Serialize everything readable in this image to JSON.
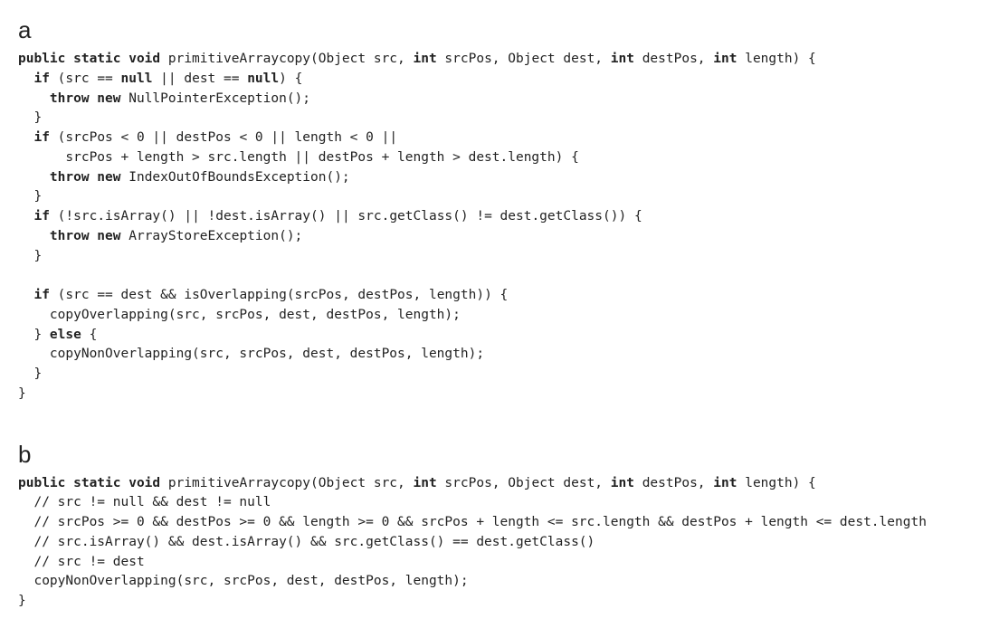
{
  "panels": {
    "a": {
      "label": "a",
      "code_tokens": [
        {
          "t": "kw",
          "v": "public static void"
        },
        {
          "t": "tx",
          "v": " primitiveArraycopy(Object src, "
        },
        {
          "t": "kw",
          "v": "int"
        },
        {
          "t": "tx",
          "v": " srcPos, Object dest, "
        },
        {
          "t": "kw",
          "v": "int"
        },
        {
          "t": "tx",
          "v": " destPos, "
        },
        {
          "t": "kw",
          "v": "int"
        },
        {
          "t": "tx",
          "v": " length) {\n"
        },
        {
          "t": "tx",
          "v": "  "
        },
        {
          "t": "kw",
          "v": "if"
        },
        {
          "t": "tx",
          "v": " (src == "
        },
        {
          "t": "kw",
          "v": "null"
        },
        {
          "t": "tx",
          "v": " || dest == "
        },
        {
          "t": "kw",
          "v": "null"
        },
        {
          "t": "tx",
          "v": ") {\n"
        },
        {
          "t": "tx",
          "v": "    "
        },
        {
          "t": "kw",
          "v": "throw new"
        },
        {
          "t": "tx",
          "v": " NullPointerException();\n"
        },
        {
          "t": "tx",
          "v": "  }\n"
        },
        {
          "t": "tx",
          "v": "  "
        },
        {
          "t": "kw",
          "v": "if"
        },
        {
          "t": "tx",
          "v": " (srcPos < 0 || destPos < 0 || length < 0 ||\n"
        },
        {
          "t": "tx",
          "v": "      srcPos + length > src.length || destPos + length > dest.length) {\n"
        },
        {
          "t": "tx",
          "v": "    "
        },
        {
          "t": "kw",
          "v": "throw new"
        },
        {
          "t": "tx",
          "v": " IndexOutOfBoundsException();\n"
        },
        {
          "t": "tx",
          "v": "  }\n"
        },
        {
          "t": "tx",
          "v": "  "
        },
        {
          "t": "kw",
          "v": "if"
        },
        {
          "t": "tx",
          "v": " (!src.isArray() || !dest.isArray() || src.getClass() != dest.getClass()) {\n"
        },
        {
          "t": "tx",
          "v": "    "
        },
        {
          "t": "kw",
          "v": "throw new"
        },
        {
          "t": "tx",
          "v": " ArrayStoreException();\n"
        },
        {
          "t": "tx",
          "v": "  }\n"
        },
        {
          "t": "tx",
          "v": "\n"
        },
        {
          "t": "tx",
          "v": "  "
        },
        {
          "t": "kw",
          "v": "if"
        },
        {
          "t": "tx",
          "v": " (src == dest && isOverlapping(srcPos, destPos, length)) {\n"
        },
        {
          "t": "tx",
          "v": "    copyOverlapping(src, srcPos, dest, destPos, length);\n"
        },
        {
          "t": "tx",
          "v": "  } "
        },
        {
          "t": "kw",
          "v": "else"
        },
        {
          "t": "tx",
          "v": " {\n"
        },
        {
          "t": "tx",
          "v": "    copyNonOverlapping(src, srcPos, dest, destPos, length);\n"
        },
        {
          "t": "tx",
          "v": "  }\n"
        },
        {
          "t": "tx",
          "v": "}\n"
        }
      ]
    },
    "b": {
      "label": "b",
      "code_tokens": [
        {
          "t": "kw",
          "v": "public static void"
        },
        {
          "t": "tx",
          "v": " primitiveArraycopy(Object src, "
        },
        {
          "t": "kw",
          "v": "int"
        },
        {
          "t": "tx",
          "v": " srcPos, Object dest, "
        },
        {
          "t": "kw",
          "v": "int"
        },
        {
          "t": "tx",
          "v": " destPos, "
        },
        {
          "t": "kw",
          "v": "int"
        },
        {
          "t": "tx",
          "v": " length) {\n"
        },
        {
          "t": "tx",
          "v": "  // src != null && dest != null\n"
        },
        {
          "t": "tx",
          "v": "  // srcPos >= 0 && destPos >= 0 && length >= 0 && srcPos + length <= src.length && destPos + length <= dest.length\n"
        },
        {
          "t": "tx",
          "v": "  // src.isArray() && dest.isArray() && src.getClass() == dest.getClass()\n"
        },
        {
          "t": "tx",
          "v": "  // src != dest\n"
        },
        {
          "t": "tx",
          "v": "  copyNonOverlapping(src, srcPos, dest, destPos, length);\n"
        },
        {
          "t": "tx",
          "v": "}\n"
        }
      ]
    }
  }
}
